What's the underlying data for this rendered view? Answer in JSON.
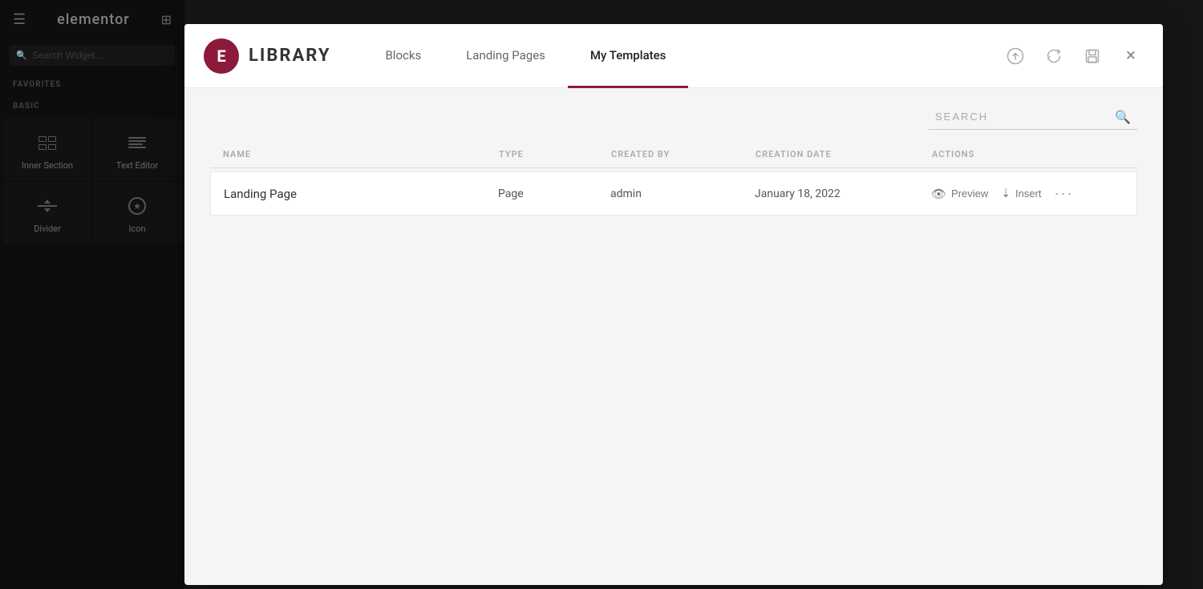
{
  "editor": {
    "logo": "elementor",
    "hamburger": "☰",
    "grid": "⊞"
  },
  "sidebar": {
    "search_placeholder": "Search Widget...",
    "favorites_label": "FAVORITES",
    "basic_label": "BASIC",
    "widgets": [
      {
        "id": "inner-section",
        "label": "Inner Section"
      },
      {
        "id": "text-editor",
        "label": "Text Editor"
      },
      {
        "id": "divider",
        "label": "Divider"
      },
      {
        "id": "icon",
        "label": "Icon"
      }
    ]
  },
  "modal": {
    "logo_letter": "E",
    "title": "LIBRARY",
    "tabs": [
      {
        "id": "blocks",
        "label": "Blocks",
        "active": false
      },
      {
        "id": "landing-pages",
        "label": "Landing Pages",
        "active": false
      },
      {
        "id": "my-templates",
        "label": "My Templates",
        "active": true
      }
    ],
    "actions": {
      "upload_label": "upload",
      "sync_label": "sync",
      "save_label": "save"
    },
    "close_label": "×",
    "search_placeholder": "SEARCH",
    "table": {
      "columns": [
        {
          "id": "name",
          "label": "NAME"
        },
        {
          "id": "type",
          "label": "TYPE"
        },
        {
          "id": "created_by",
          "label": "CREATED BY"
        },
        {
          "id": "creation_date",
          "label": "CREATION DATE"
        },
        {
          "id": "actions",
          "label": "ACTIONS"
        }
      ],
      "rows": [
        {
          "name": "Landing Page",
          "type": "Page",
          "created_by": "admin",
          "creation_date": "January 18, 2022",
          "preview_label": "Preview",
          "insert_label": "Insert"
        }
      ]
    }
  }
}
